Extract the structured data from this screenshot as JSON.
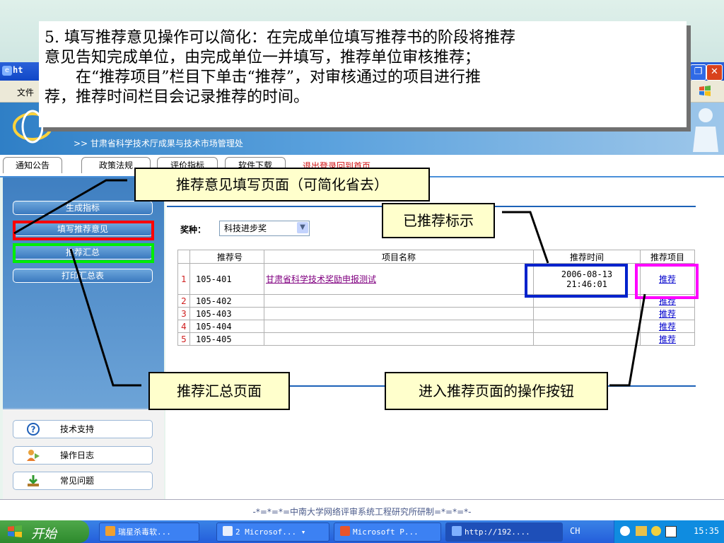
{
  "annotation": {
    "line1": "5. 填写推荐意见操作可以简化：在完成单位填写推荐书的阶段将推荐",
    "line2": "意见告知完成单位，由完成单位一并填写，推荐单位审核推荐；",
    "line3": "在“推荐项目”栏目下单击“推荐”，对审核通过的项目进行推",
    "line4": "荐，推荐时间栏目会记录推荐的时间。"
  },
  "window": {
    "title": "ht",
    "menu_file": "文件"
  },
  "banner": {
    "subtitle": ">> 甘肃省科学技术厅成果与技术市场管理处"
  },
  "nav": {
    "tabs": [
      "通知公告",
      "政策法规",
      "评价指标",
      "软件下载"
    ],
    "logout": "退出登录回到首页"
  },
  "sidebar": {
    "buttons": [
      "生成指标",
      "填写推荐意见",
      "推荐汇总",
      "打印汇总表"
    ],
    "lower": [
      {
        "label": "技术支持",
        "icon": "help-icon"
      },
      {
        "label": "操作日志",
        "icon": "users-icon"
      },
      {
        "label": "常见问题",
        "icon": "download-icon"
      }
    ]
  },
  "form": {
    "award_label": "奖种：",
    "award_value": "科技进步奖"
  },
  "table": {
    "headers": [
      "",
      "推荐号",
      "项目名称",
      "推荐时间",
      "推荐项目"
    ],
    "rows": [
      {
        "idx": "1",
        "no": "105-401",
        "name": "甘肃省科学技术奖励申报测试",
        "time_date": "2006-08-13",
        "time_clock": "21:46:01",
        "action": "推荐"
      },
      {
        "idx": "2",
        "no": "105-402",
        "name": "",
        "time_date": "",
        "time_clock": "",
        "action": "推荐"
      },
      {
        "idx": "3",
        "no": "105-403",
        "name": "",
        "time_date": "",
        "time_clock": "",
        "action": "推荐"
      },
      {
        "idx": "4",
        "no": "105-404",
        "name": "",
        "time_date": "",
        "time_clock": "",
        "action": "推荐"
      },
      {
        "idx": "5",
        "no": "105-405",
        "name": "",
        "time_date": "",
        "time_clock": "",
        "action": "推荐"
      }
    ]
  },
  "callouts": {
    "opinion_page": "推荐意见填写页面（可简化省去）",
    "marker": "已推荐标示",
    "summary_page": "推荐汇总页面",
    "action_button": "进入推荐页面的操作按钮"
  },
  "footer": "-*=*=*=中南大学网络评审系统工程研究所研制=*=*=*-",
  "taskbar": {
    "start": "开始",
    "items": [
      "瑞星杀毒软...",
      "2 Microsof...",
      "Microsoft P...",
      "http://192...."
    ],
    "lang": "CH",
    "clock": "15:35"
  },
  "colors": {
    "highlight_red": "#ff0000",
    "highlight_green": "#00ee00",
    "highlight_blue": "#0022cc",
    "highlight_magenta": "#ff00ff",
    "callout_bg": "#ffffcc"
  }
}
